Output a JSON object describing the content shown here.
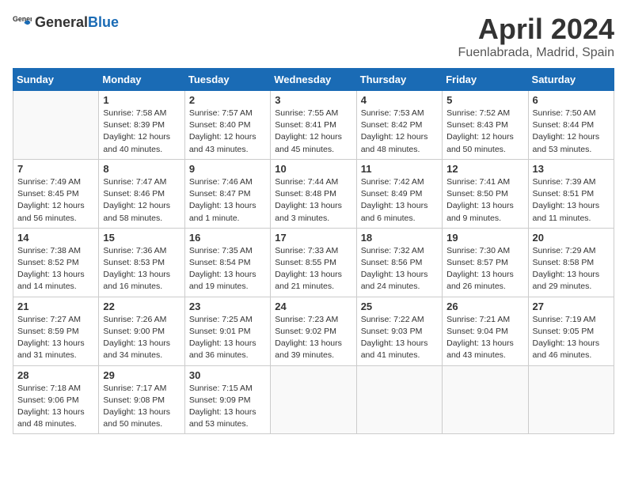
{
  "header": {
    "logo_general": "General",
    "logo_blue": "Blue",
    "title": "April 2024",
    "subtitle": "Fuenlabrada, Madrid, Spain"
  },
  "days_of_week": [
    "Sunday",
    "Monday",
    "Tuesday",
    "Wednesday",
    "Thursday",
    "Friday",
    "Saturday"
  ],
  "weeks": [
    [
      {
        "day": "",
        "info": ""
      },
      {
        "day": "1",
        "info": "Sunrise: 7:58 AM\nSunset: 8:39 PM\nDaylight: 12 hours\nand 40 minutes."
      },
      {
        "day": "2",
        "info": "Sunrise: 7:57 AM\nSunset: 8:40 PM\nDaylight: 12 hours\nand 43 minutes."
      },
      {
        "day": "3",
        "info": "Sunrise: 7:55 AM\nSunset: 8:41 PM\nDaylight: 12 hours\nand 45 minutes."
      },
      {
        "day": "4",
        "info": "Sunrise: 7:53 AM\nSunset: 8:42 PM\nDaylight: 12 hours\nand 48 minutes."
      },
      {
        "day": "5",
        "info": "Sunrise: 7:52 AM\nSunset: 8:43 PM\nDaylight: 12 hours\nand 50 minutes."
      },
      {
        "day": "6",
        "info": "Sunrise: 7:50 AM\nSunset: 8:44 PM\nDaylight: 12 hours\nand 53 minutes."
      }
    ],
    [
      {
        "day": "7",
        "info": "Sunrise: 7:49 AM\nSunset: 8:45 PM\nDaylight: 12 hours\nand 56 minutes."
      },
      {
        "day": "8",
        "info": "Sunrise: 7:47 AM\nSunset: 8:46 PM\nDaylight: 12 hours\nand 58 minutes."
      },
      {
        "day": "9",
        "info": "Sunrise: 7:46 AM\nSunset: 8:47 PM\nDaylight: 13 hours\nand 1 minute."
      },
      {
        "day": "10",
        "info": "Sunrise: 7:44 AM\nSunset: 8:48 PM\nDaylight: 13 hours\nand 3 minutes."
      },
      {
        "day": "11",
        "info": "Sunrise: 7:42 AM\nSunset: 8:49 PM\nDaylight: 13 hours\nand 6 minutes."
      },
      {
        "day": "12",
        "info": "Sunrise: 7:41 AM\nSunset: 8:50 PM\nDaylight: 13 hours\nand 9 minutes."
      },
      {
        "day": "13",
        "info": "Sunrise: 7:39 AM\nSunset: 8:51 PM\nDaylight: 13 hours\nand 11 minutes."
      }
    ],
    [
      {
        "day": "14",
        "info": "Sunrise: 7:38 AM\nSunset: 8:52 PM\nDaylight: 13 hours\nand 14 minutes."
      },
      {
        "day": "15",
        "info": "Sunrise: 7:36 AM\nSunset: 8:53 PM\nDaylight: 13 hours\nand 16 minutes."
      },
      {
        "day": "16",
        "info": "Sunrise: 7:35 AM\nSunset: 8:54 PM\nDaylight: 13 hours\nand 19 minutes."
      },
      {
        "day": "17",
        "info": "Sunrise: 7:33 AM\nSunset: 8:55 PM\nDaylight: 13 hours\nand 21 minutes."
      },
      {
        "day": "18",
        "info": "Sunrise: 7:32 AM\nSunset: 8:56 PM\nDaylight: 13 hours\nand 24 minutes."
      },
      {
        "day": "19",
        "info": "Sunrise: 7:30 AM\nSunset: 8:57 PM\nDaylight: 13 hours\nand 26 minutes."
      },
      {
        "day": "20",
        "info": "Sunrise: 7:29 AM\nSunset: 8:58 PM\nDaylight: 13 hours\nand 29 minutes."
      }
    ],
    [
      {
        "day": "21",
        "info": "Sunrise: 7:27 AM\nSunset: 8:59 PM\nDaylight: 13 hours\nand 31 minutes."
      },
      {
        "day": "22",
        "info": "Sunrise: 7:26 AM\nSunset: 9:00 PM\nDaylight: 13 hours\nand 34 minutes."
      },
      {
        "day": "23",
        "info": "Sunrise: 7:25 AM\nSunset: 9:01 PM\nDaylight: 13 hours\nand 36 minutes."
      },
      {
        "day": "24",
        "info": "Sunrise: 7:23 AM\nSunset: 9:02 PM\nDaylight: 13 hours\nand 39 minutes."
      },
      {
        "day": "25",
        "info": "Sunrise: 7:22 AM\nSunset: 9:03 PM\nDaylight: 13 hours\nand 41 minutes."
      },
      {
        "day": "26",
        "info": "Sunrise: 7:21 AM\nSunset: 9:04 PM\nDaylight: 13 hours\nand 43 minutes."
      },
      {
        "day": "27",
        "info": "Sunrise: 7:19 AM\nSunset: 9:05 PM\nDaylight: 13 hours\nand 46 minutes."
      }
    ],
    [
      {
        "day": "28",
        "info": "Sunrise: 7:18 AM\nSunset: 9:06 PM\nDaylight: 13 hours\nand 48 minutes."
      },
      {
        "day": "29",
        "info": "Sunrise: 7:17 AM\nSunset: 9:08 PM\nDaylight: 13 hours\nand 50 minutes."
      },
      {
        "day": "30",
        "info": "Sunrise: 7:15 AM\nSunset: 9:09 PM\nDaylight: 13 hours\nand 53 minutes."
      },
      {
        "day": "",
        "info": ""
      },
      {
        "day": "",
        "info": ""
      },
      {
        "day": "",
        "info": ""
      },
      {
        "day": "",
        "info": ""
      }
    ]
  ]
}
